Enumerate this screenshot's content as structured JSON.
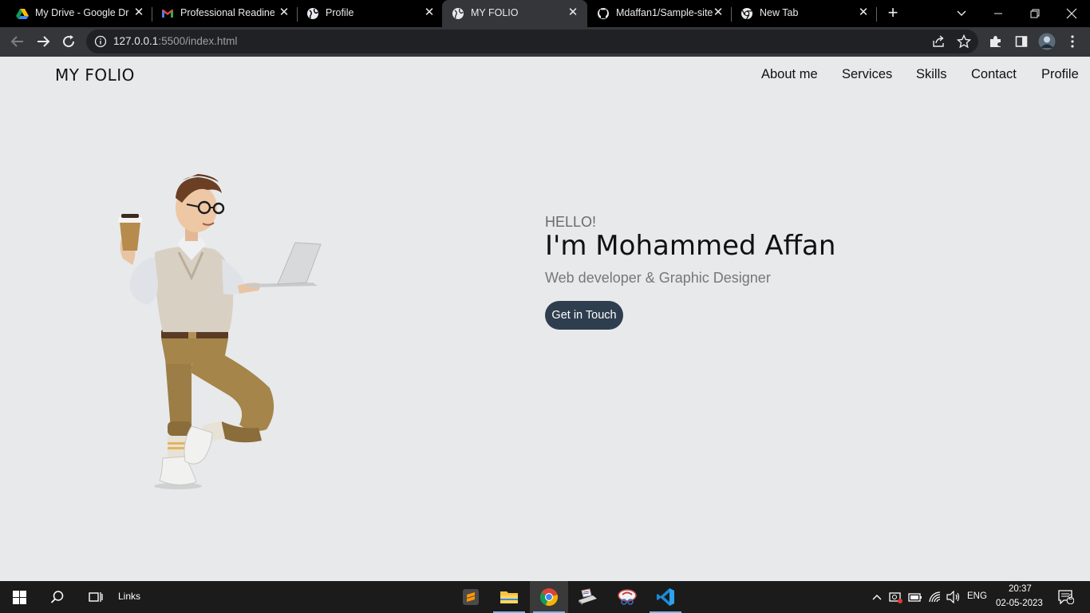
{
  "browser": {
    "tabs": [
      {
        "title": "My Drive - Google Dri",
        "icon": "google-drive-icon"
      },
      {
        "title": "Professional Readiness",
        "icon": "gmail-icon"
      },
      {
        "title": "Profile",
        "icon": "globe-icon"
      },
      {
        "title": "MY FOLIO",
        "icon": "globe-icon",
        "active": true
      },
      {
        "title": "Mdaffan1/Sample-site",
        "icon": "github-icon"
      },
      {
        "title": "New Tab",
        "icon": "chrome-icon"
      }
    ],
    "url_host": "127.0.0.1",
    "url_rest": ":5500/index.html"
  },
  "site": {
    "logo": "MY FOLIO",
    "nav": [
      "About me",
      "Services",
      "Skills",
      "Contact",
      "Profile"
    ],
    "hero": {
      "greeting": "HELLO!",
      "name": "I'm Mohammed Affan",
      "role": "Web developer & Graphic Designer",
      "cta": "Get in Touch"
    }
  },
  "taskbar": {
    "links_label": "Links",
    "language": "ENG",
    "time": "20:37",
    "date": "02-05-2023",
    "notifications": "2"
  },
  "colors": {
    "page_bg": "#e8e9eb",
    "cta_bg": "#2f3e4e",
    "chrome_dark": "#35363a"
  }
}
